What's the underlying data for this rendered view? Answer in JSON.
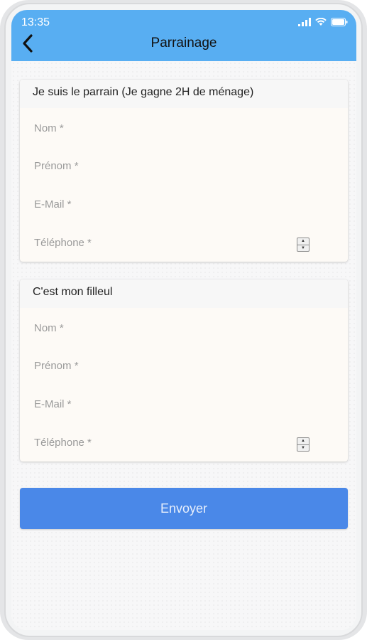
{
  "status_bar": {
    "time": "13:35",
    "icons": [
      "signal-icon",
      "wifi-icon",
      "battery-icon"
    ]
  },
  "header": {
    "back_icon": "chevron-left-icon",
    "title": "Parrainage"
  },
  "sponsor_card": {
    "title": "Je suis le parrain (Je gagne 2H de ménage)",
    "fields": {
      "last_name": "Nom *",
      "first_name": "Prénom *",
      "email": "E-Mail *",
      "phone": "Téléphone *"
    }
  },
  "referral_card": {
    "title": "C'est mon filleul",
    "fields": {
      "last_name": "Nom *",
      "first_name": "Prénom *",
      "email": "E-Mail *",
      "phone": "Téléphone *"
    }
  },
  "submit_label": "Envoyer",
  "colors": {
    "header": "#58aef2",
    "button": "#4a88e8",
    "card": "#fdfaf6"
  }
}
